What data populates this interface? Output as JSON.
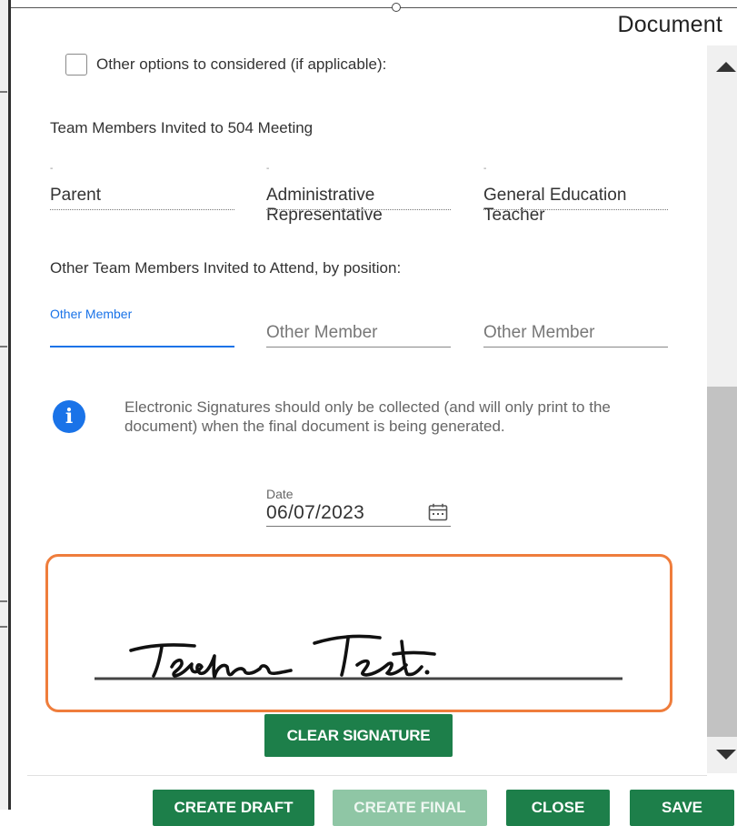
{
  "window": {
    "title": "Document"
  },
  "other_options": {
    "label": "Other options to considered (if applicable):",
    "checked": false
  },
  "team_section": {
    "title": "Team Members Invited to 504 Meeting",
    "members": [
      {
        "dot": "-",
        "line1": "Parent",
        "line2": ""
      },
      {
        "dot": "-",
        "line1": "Administrative",
        "line2": "Representative"
      },
      {
        "dot": "-",
        "line1": "General Education",
        "line2": "Teacher"
      }
    ]
  },
  "other_team": {
    "title": "Other Team Members Invited to Attend, by position:",
    "fields": [
      {
        "label": "Other Member",
        "value": ""
      },
      {
        "placeholder": "Other Member"
      },
      {
        "placeholder": "Other Member"
      }
    ]
  },
  "info": {
    "icon": "info-icon",
    "text": "Electronic Signatures should only be collected (and will only print to the document) when the final document is being generated."
  },
  "date_field": {
    "label": "Date",
    "value": "06/07/2023",
    "icon": "calendar-icon"
  },
  "signature": {
    "handwritten_text": "Teacher Test."
  },
  "buttons": {
    "clear_signature": "CLEAR SIGNATURE",
    "create_draft": "CREATE DRAFT",
    "create_final": "CREATE FINAL",
    "close": "CLOSE",
    "save": "SAVE"
  },
  "colors": {
    "accent_blue": "#1a73e8",
    "button_green": "#1d7f4a",
    "button_disabled": "#8fc6a5",
    "signature_border": "#ef7d3c"
  }
}
